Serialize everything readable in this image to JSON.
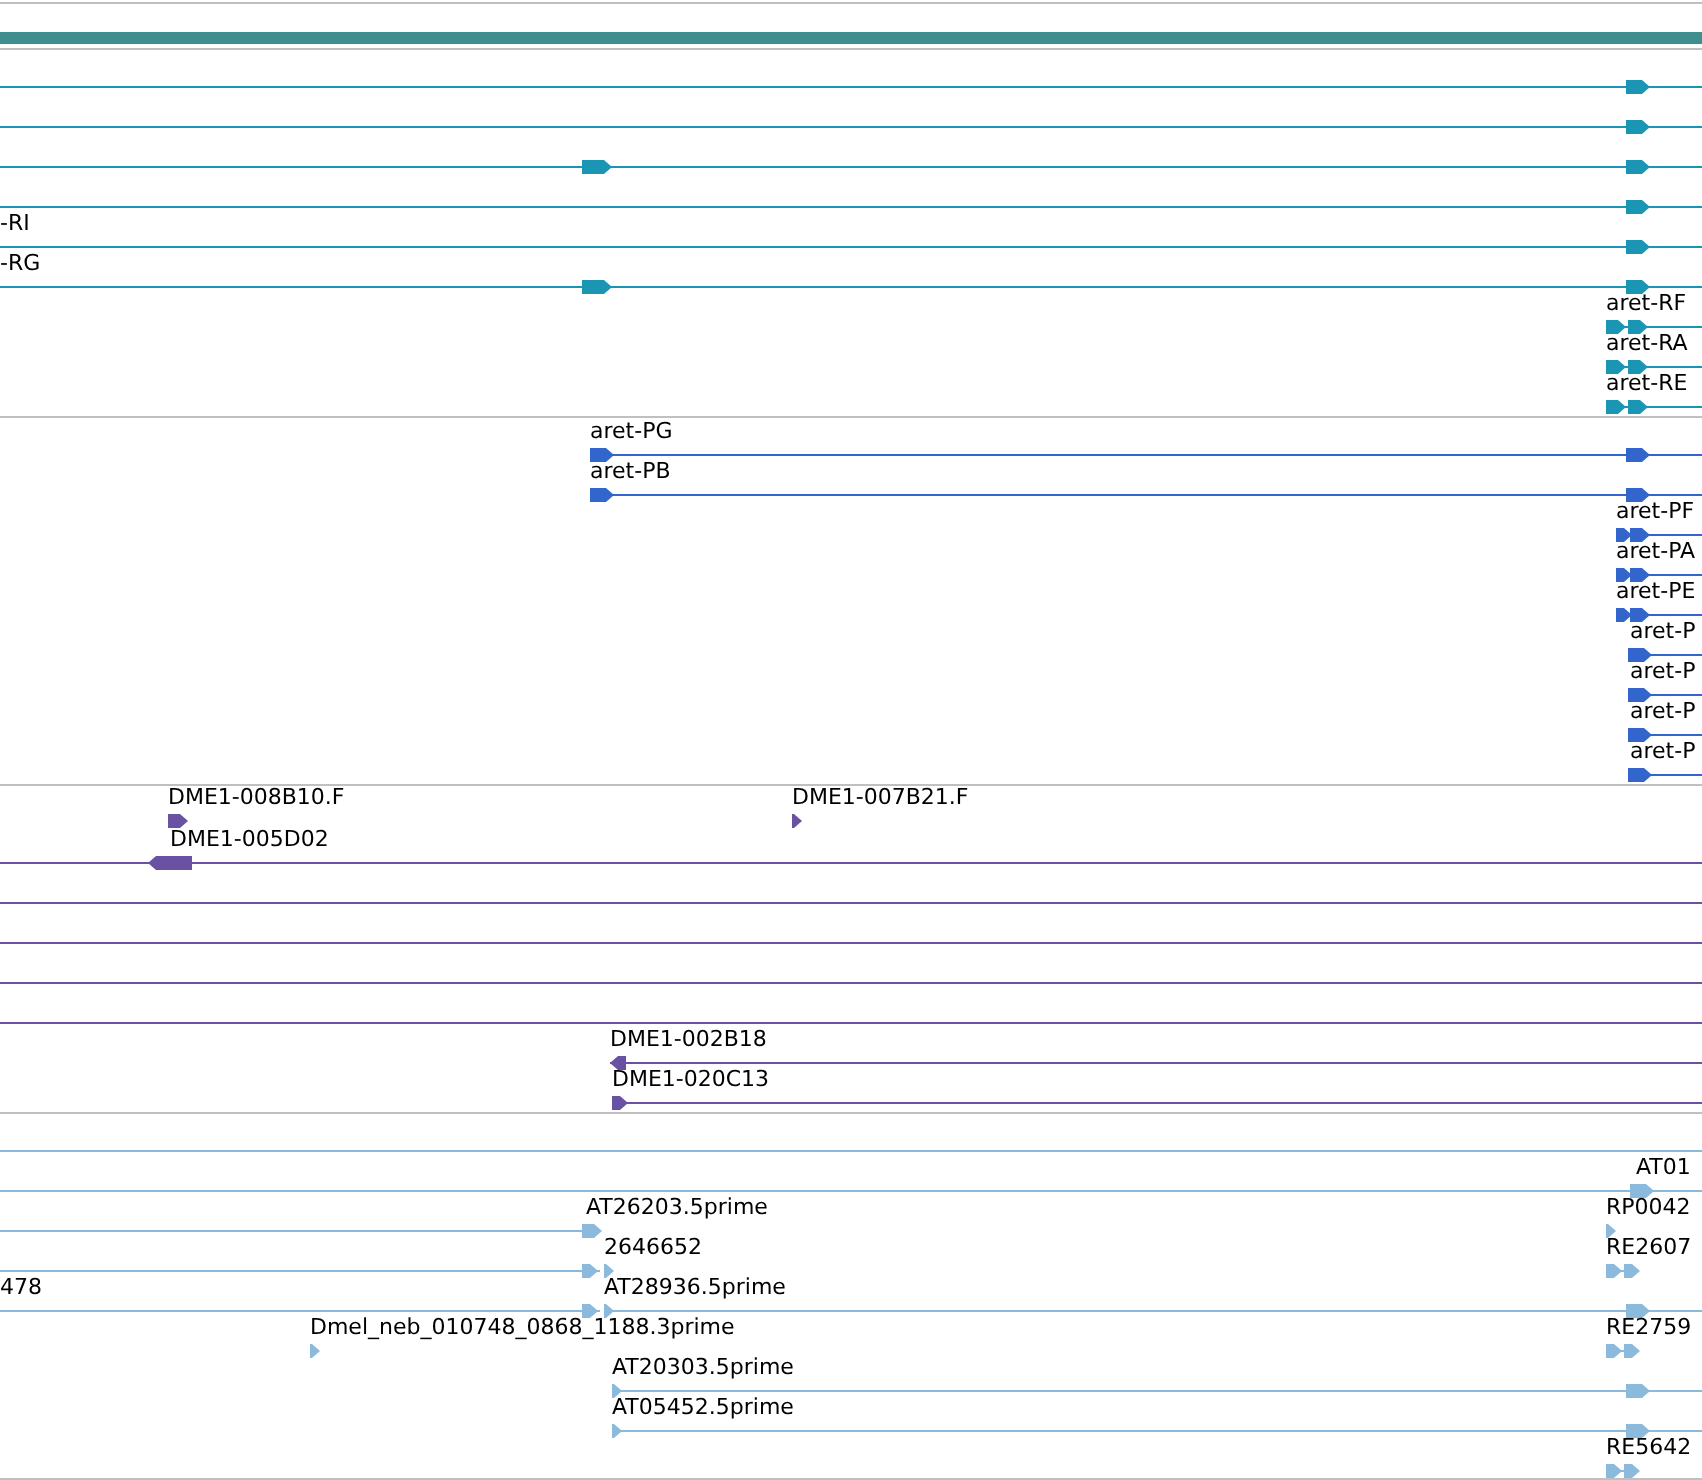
{
  "tracks": [
    {
      "color": "#1a96b4",
      "labels": [
        "-RI",
        "-RG",
        "aret-RF",
        "aret-RA",
        "aret-RE"
      ]
    },
    {
      "color": "#3366cc",
      "labels": [
        "aret-PG",
        "aret-PB",
        "aret-PF",
        "aret-PA",
        "aret-PE",
        "aret-P",
        "aret-P",
        "aret-P",
        "aret-P"
      ]
    },
    {
      "color": "#6a52a3",
      "labels": [
        "DME1-008B10.F",
        "DME1-007B21.F",
        "DME1-005D02",
        "DME1-002B18",
        "DME1-020C13"
      ]
    },
    {
      "color": "#8bbadc",
      "labels": [
        "AT01",
        "AT26203.5prime",
        "RP0042",
        "2646652",
        "RE2607",
        "478",
        "AT28936.5prime",
        "Dmel_neb_010748_0868_1188.3prime",
        "RE2759",
        "AT20303.5prime",
        "AT05452.5prime",
        "RE5642"
      ]
    }
  ]
}
